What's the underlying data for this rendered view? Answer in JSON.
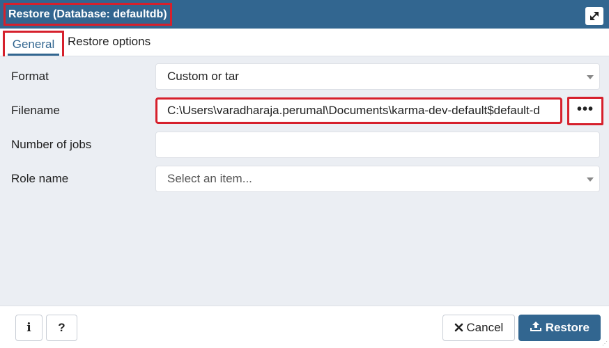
{
  "dialog": {
    "title": "Restore (Database: defaultdb)"
  },
  "tabs": [
    {
      "label": "General",
      "active": true
    },
    {
      "label": "Restore options",
      "active": false
    }
  ],
  "form": {
    "format": {
      "label": "Format",
      "value": "Custom or tar"
    },
    "filename": {
      "label": "Filename",
      "value": "C:\\Users\\varadharaja.perumal\\Documents\\karma-dev-default$default-d",
      "browse_label": "•••"
    },
    "jobs": {
      "label": "Number of jobs",
      "value": ""
    },
    "role": {
      "label": "Role name",
      "placeholder": "Select an item..."
    }
  },
  "footer": {
    "info_label": "i",
    "help_label": "?",
    "cancel_label": "Cancel",
    "restore_label": "Restore"
  },
  "colors": {
    "header": "#326690",
    "highlight": "#d6202c",
    "content_bg": "#ebeef3"
  },
  "icons": {
    "maximize": "maximize-icon",
    "cancel": "x-icon",
    "restore": "upload-icon",
    "dropdown": "caret-down-icon"
  }
}
